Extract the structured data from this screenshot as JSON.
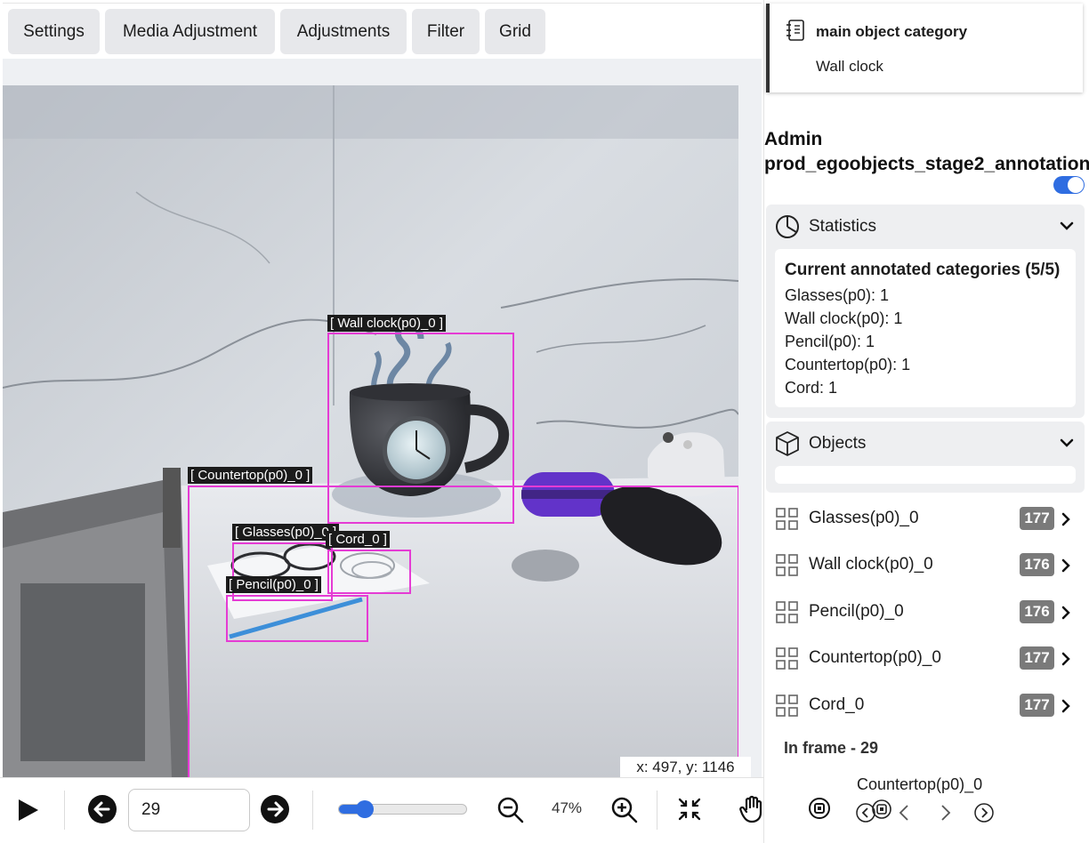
{
  "toolbar": {
    "tabs": [
      "Settings",
      "Media Adjustment",
      "Adjustments",
      "Filter",
      "Grid"
    ]
  },
  "canvas": {
    "annotations": [
      {
        "label": "[ Wall clock(p0)_0 ]"
      },
      {
        "label": "[ Countertop(p0)_0 ]"
      },
      {
        "label": "[ Glasses(p0)_0 ]"
      },
      {
        "label": "[ Cord_0 ]"
      },
      {
        "label": "[ Pencil(p0)_0 ]"
      }
    ],
    "box_color": "#e53bd4",
    "cursor_readout": "x: 497, y: 1146"
  },
  "bottom": {
    "frame_value": "29",
    "zoom_level": 47,
    "zoom_text": "47%",
    "accent": "#2f6de1"
  },
  "panel": {
    "category_title": "main object category",
    "category_value": "Wall clock",
    "project_line1": "Admin",
    "project_line2": "prod_egoobjects_stage2_annotation",
    "statistics": {
      "title": "Statistics",
      "heading": "Current annotated categories (5/5)",
      "lines": [
        "Glasses(p0): 1",
        "Wall clock(p0): 1",
        "Pencil(p0): 1",
        "Countertop(p0): 1",
        "Cord: 1"
      ]
    },
    "objects": {
      "title": "Objects",
      "items": [
        {
          "name": "Glasses(p0)_0",
          "count": "177"
        },
        {
          "name": "Wall clock(p0)_0",
          "count": "176"
        },
        {
          "name": "Pencil(p0)_0",
          "count": "176"
        },
        {
          "name": "Countertop(p0)_0",
          "count": "177"
        },
        {
          "name": "Cord_0",
          "count": "177"
        }
      ]
    },
    "in_frame": "In frame - 29",
    "current_object": "Countertop(p0)_0"
  }
}
